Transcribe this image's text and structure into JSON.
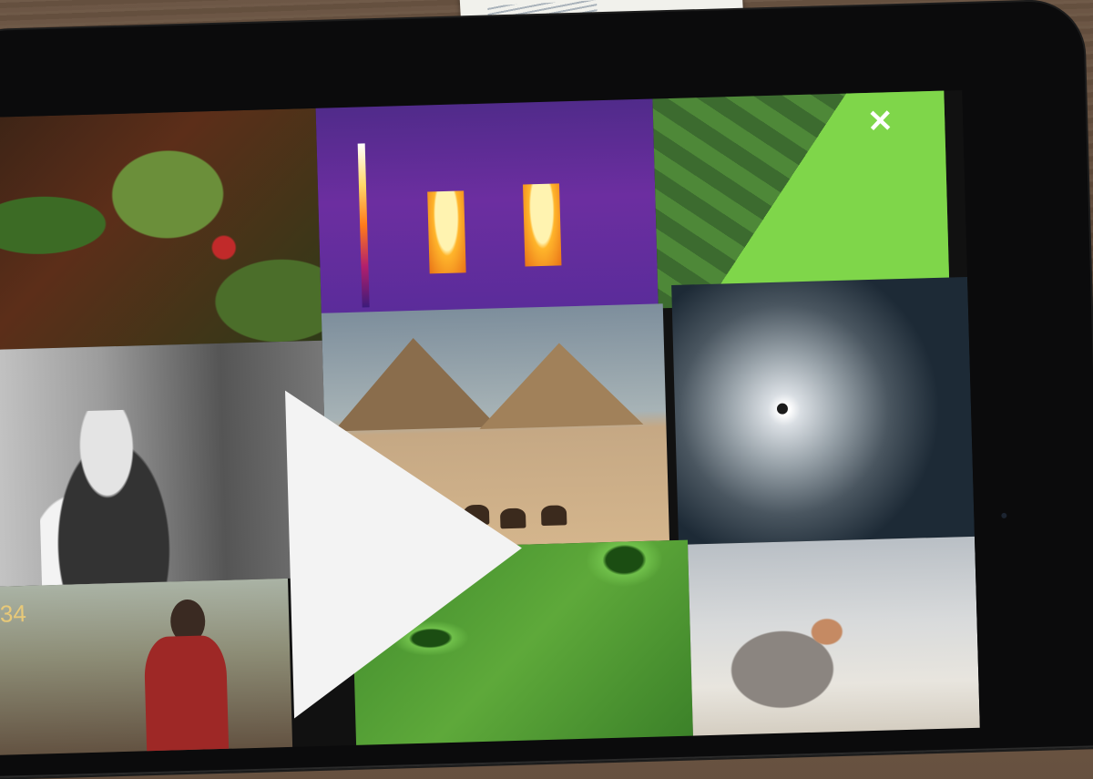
{
  "page": {
    "number": "34"
  },
  "scene": {
    "close_icon_glyph": "✕",
    "play_icon": "play-icon",
    "tiles": [
      "forest",
      "thermal-image",
      "leaf",
      "portrait",
      "pyramids",
      "hurricane",
      "people",
      "leaf-stomata",
      "beach"
    ]
  }
}
